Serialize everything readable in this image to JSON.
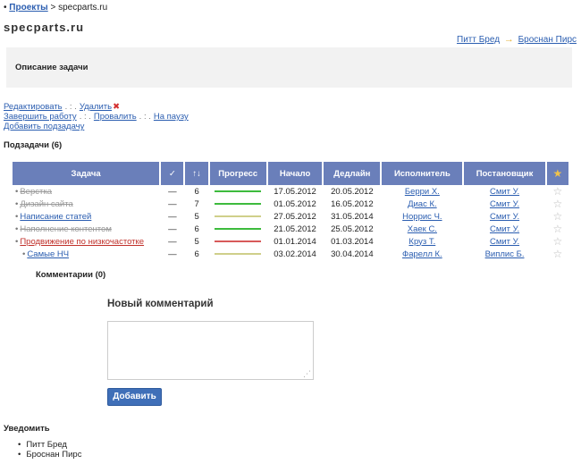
{
  "breadcrumb": {
    "bullet": "•",
    "projects": "Проекты",
    "sep": " > ",
    "current": "specparts.ru"
  },
  "title": "specparts.ru",
  "people": {
    "from": "Питт Бред",
    "arrow": "→",
    "to": "Броснан Пирс"
  },
  "description": {
    "label": "Описание задачи"
  },
  "actions": {
    "edit": "Редактировать",
    "delete": "Удалить",
    "finish": "Завершить работу",
    "fail": "Провалить",
    "pause": "На паузу",
    "add_subtask": "Добавить подзадачу",
    "separator": ". : ."
  },
  "subtasks": {
    "title": "Подзадачи (6)",
    "headers": [
      "Задача",
      "✓",
      "↑↓",
      "Прогресс",
      "Начало",
      "Дедлайн",
      "Исполнитель",
      "Постановщик",
      "★"
    ],
    "rows": [
      {
        "name": "Верстка",
        "status": "done",
        "check": "—",
        "priority": "6",
        "progress_color": "#3dbb3d",
        "start": "17.05.2012",
        "deadline": "20.05.2012",
        "assignee": "Берри Х.",
        "creator": "Смит У.",
        "star": "☆"
      },
      {
        "name": "Дизайн сайта",
        "status": "done",
        "check": "—",
        "priority": "7",
        "progress_color": "#3dbb3d",
        "start": "01.05.2012",
        "deadline": "16.05.2012",
        "assignee": "Диас К.",
        "creator": "Смит У.",
        "star": "☆"
      },
      {
        "name": "Написание статей",
        "status": "active",
        "check": "—",
        "priority": "5",
        "progress_color": "#cfcf8a",
        "start": "27.05.2012",
        "deadline": "31.05.2014",
        "assignee": "Норрис Ч.",
        "creator": "Смит У.",
        "star": "☆"
      },
      {
        "name": "Наполнение контентом",
        "status": "done",
        "check": "—",
        "priority": "6",
        "progress_color": "#3dbb3d",
        "start": "21.05.2012",
        "deadline": "25.05.2012",
        "assignee": "Хаек С.",
        "creator": "Смит У.",
        "star": "☆"
      },
      {
        "name": "Продвижение по низкочастотке",
        "status": "overdue",
        "check": "—",
        "priority": "5",
        "progress_color": "#d85a5a",
        "start": "01.01.2014",
        "deadline": "01.03.2014",
        "assignee": "Круз Т.",
        "creator": "Смит У.",
        "star": "☆"
      },
      {
        "name": "Самые НЧ",
        "status": "child",
        "check": "—",
        "priority": "6",
        "progress_color": "#cfcf8a",
        "start": "03.02.2014",
        "deadline": "30.04.2014",
        "assignee": "Фарелл К.",
        "creator": "Виплис Б.",
        "star": "☆"
      }
    ]
  },
  "comments": {
    "title": "Комментарии (0)",
    "new_title": "Новый комментарий",
    "textarea_value": "",
    "submit": "Добавить"
  },
  "notify": {
    "title": "Уведомить",
    "people": [
      "Питт Бред",
      "Броснан Пирс"
    ]
  }
}
